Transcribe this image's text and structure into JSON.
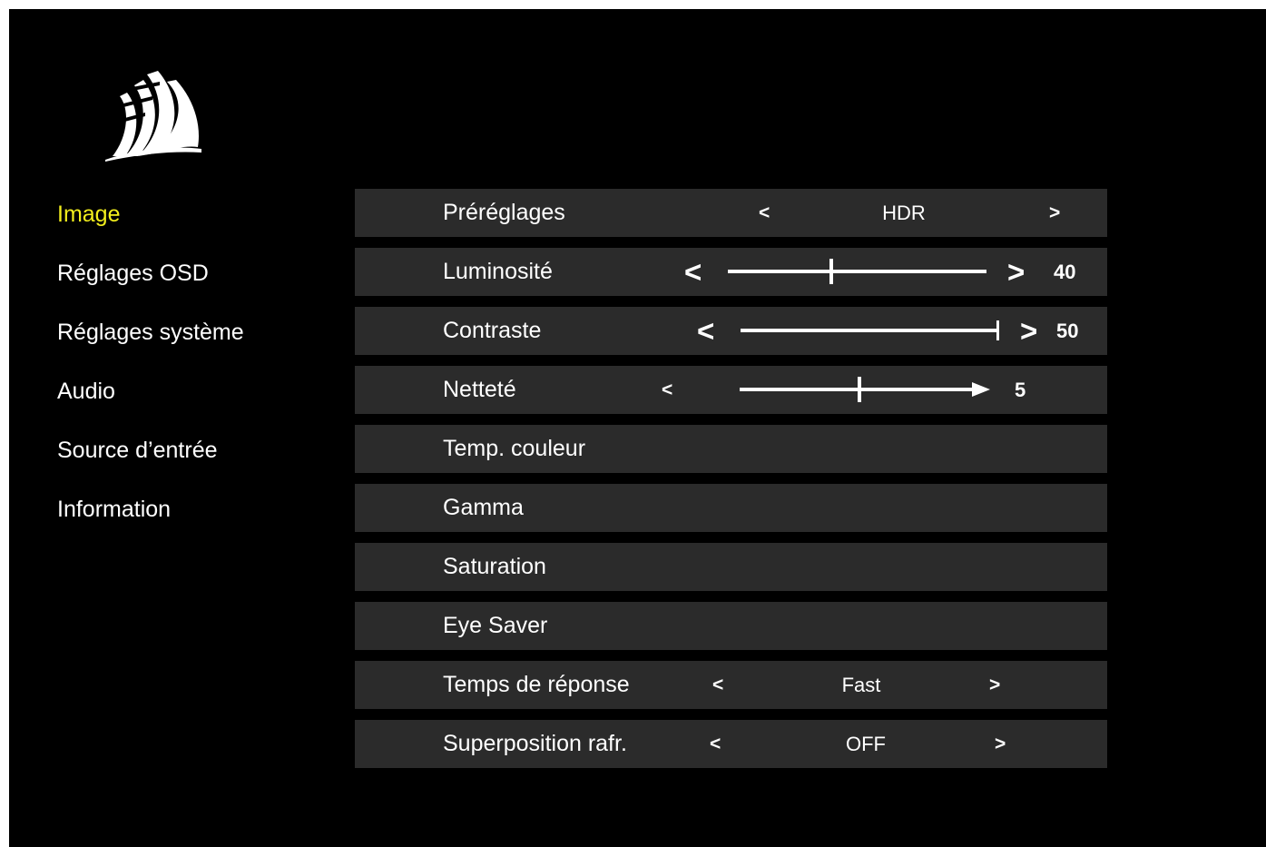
{
  "nav": {
    "items": [
      {
        "label": "Image",
        "active": true
      },
      {
        "label": "Réglages OSD",
        "active": false
      },
      {
        "label": "Réglages système",
        "active": false
      },
      {
        "label": "Audio",
        "active": false
      },
      {
        "label": "Source d’entrée",
        "active": false
      },
      {
        "label": "Information",
        "active": false
      }
    ],
    "active_color": "#f2ee1c"
  },
  "arrows": {
    "left": "<",
    "right": ">"
  },
  "settings": {
    "presets": {
      "label": "Préréglages",
      "value": "HDR"
    },
    "brightness": {
      "label": "Luminosité",
      "value": "40",
      "level": 40,
      "max": 100
    },
    "contrast": {
      "label": "Contraste",
      "value": "50",
      "level": 100,
      "max": 100
    },
    "sharpness": {
      "label": "Netteté",
      "value": "5",
      "level": 50,
      "max": 100
    },
    "color_temp": {
      "label": "Temp. couleur"
    },
    "gamma": {
      "label": "Gamma"
    },
    "saturation": {
      "label": "Saturation"
    },
    "eye_saver": {
      "label": "Eye Saver"
    },
    "response_time": {
      "label": "Temps de réponse",
      "value": "Fast"
    },
    "overlay_refresh": {
      "label": "Superposition rafr.",
      "value": "OFF"
    }
  },
  "colors": {
    "background": "#000000",
    "row_background": "#2b2b2b",
    "text": "#ffffff"
  },
  "icons": {
    "logo": "corsair-sails-logo"
  }
}
